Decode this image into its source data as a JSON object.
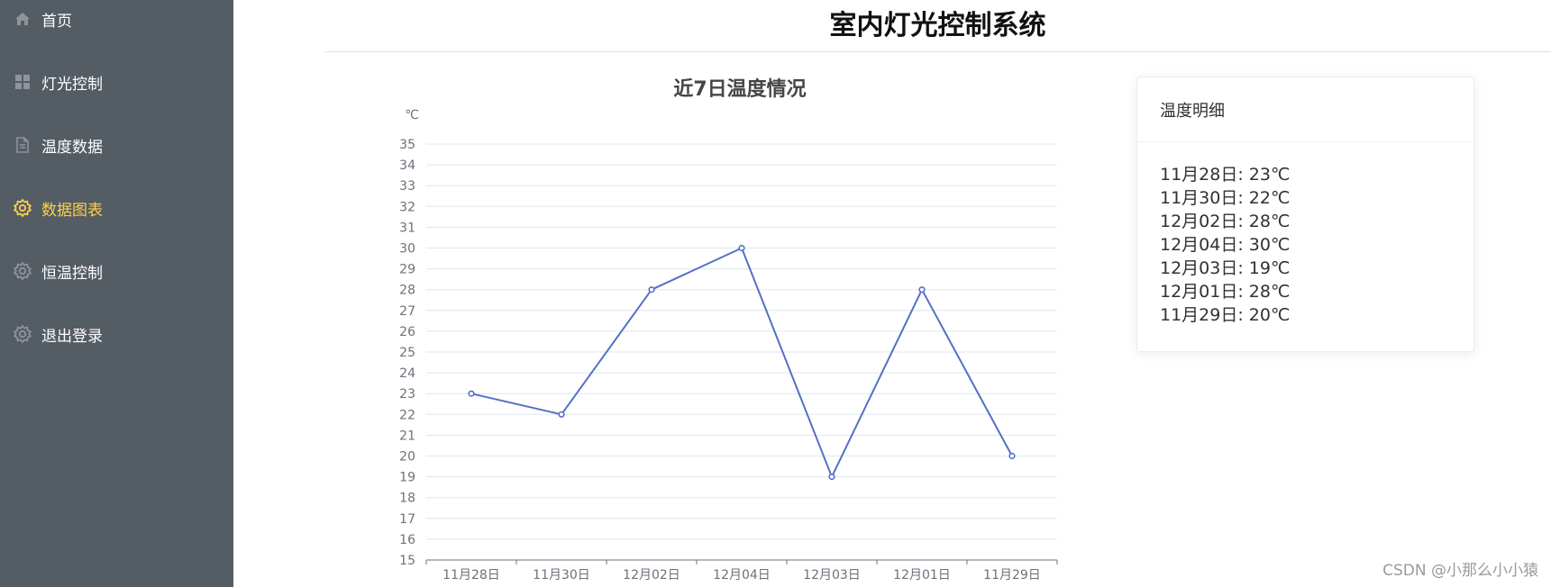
{
  "sidebar": {
    "items": [
      {
        "label": "首页",
        "icon": "home-icon",
        "active": false
      },
      {
        "label": "灯光控制",
        "icon": "grid-icon",
        "active": false
      },
      {
        "label": "温度数据",
        "icon": "document-icon",
        "active": false
      },
      {
        "label": "数据图表",
        "icon": "gear-icon",
        "active": true
      },
      {
        "label": "恒温控制",
        "icon": "gear-icon",
        "active": false
      },
      {
        "label": "退出登录",
        "icon": "gear-icon",
        "active": false
      }
    ],
    "active_color": "#ffd04b",
    "bg_color": "#545c64"
  },
  "header": {
    "title": "室内灯光控制系统"
  },
  "chart_data": {
    "type": "line",
    "title": "近7日温度情况",
    "ylabel": "℃",
    "xlabel": "",
    "categories": [
      "11月28日",
      "11月30日",
      "12月02日",
      "12月04日",
      "12月03日",
      "12月01日",
      "11月29日"
    ],
    "values": [
      23,
      22,
      28,
      30,
      19,
      28,
      20
    ],
    "ylim": [
      15,
      35
    ],
    "yticks": [
      15,
      16,
      17,
      18,
      19,
      20,
      21,
      22,
      23,
      24,
      25,
      26,
      27,
      28,
      29,
      30,
      31,
      32,
      33,
      34,
      35
    ],
    "grid": true,
    "line_color": "#5470c6"
  },
  "detail_card": {
    "title": "温度明细",
    "items": [
      "11月28日: 23℃",
      "11月30日: 22℃",
      "12月02日: 28℃",
      "12月04日: 30℃",
      "12月03日: 19℃",
      "12月01日: 28℃",
      "11月29日: 20℃"
    ]
  },
  "watermark": "CSDN @小那么小小猿"
}
